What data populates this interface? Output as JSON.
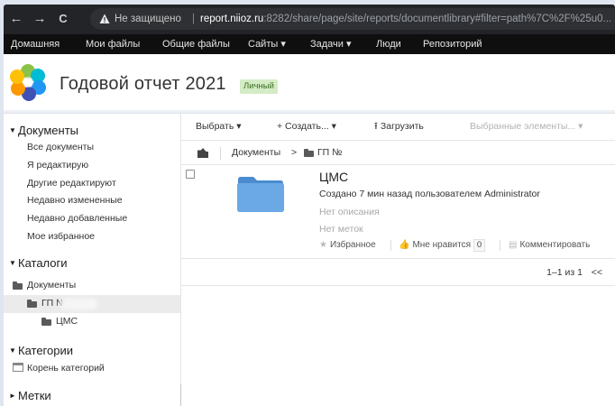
{
  "browser": {
    "back_icon": "←",
    "forward_icon": "→",
    "reload_icon": "C",
    "insecure_label": "Не защищено",
    "separator": "|",
    "url_host": "report.niioz.ru",
    "url_path": ":8282/share/page/site/reports/documentlibrary#filter=path%7C%2F%25u0..."
  },
  "topnav": {
    "items": [
      "Домашняя",
      "Мои файлы",
      "Общие файлы",
      "Сайты ▾",
      "Задачи ▾",
      "Люди",
      "Репозиторий"
    ]
  },
  "site": {
    "title": "Годовой отчет 2021",
    "badge": "Личный"
  },
  "sidebar": {
    "documents": {
      "heading": "Документы",
      "links": [
        "Все документы",
        "Я редактирую",
        "Другие редактируют",
        "Недавно измененные",
        "Недавно добавленные",
        "Мое избранное"
      ]
    },
    "catalogs": {
      "heading": "Каталоги",
      "root": "Документы",
      "folder": "ГП №",
      "subfolder": "ЦМС"
    },
    "categories": {
      "heading": "Категории",
      "root": "Корень категорий"
    },
    "tags": {
      "heading": "Метки"
    }
  },
  "toolbar": {
    "select": "Выбрать ▾",
    "create": "+ Создать... ▾",
    "upload": "Загрузить",
    "selected_items": "Выбранные элементы... ▾"
  },
  "breadcrumb": {
    "root": "Документы",
    "separator": ">",
    "current": "ГП №"
  },
  "document": {
    "name": "ЦМС",
    "created": "Создано 7 мин назад пользователем Administrator",
    "no_description": "Нет описания",
    "no_tags": "Нет меток",
    "favorite": "Избранное",
    "like": "Мне нравится",
    "like_count": "0",
    "comment": "Комментировать"
  },
  "pager": {
    "range": "1–1 из 1",
    "prev": "<<"
  },
  "colors": {
    "folder_blue": "#5b9bd5",
    "badge_bg": "#d4ecc5",
    "chrome_bg": "#232427"
  }
}
